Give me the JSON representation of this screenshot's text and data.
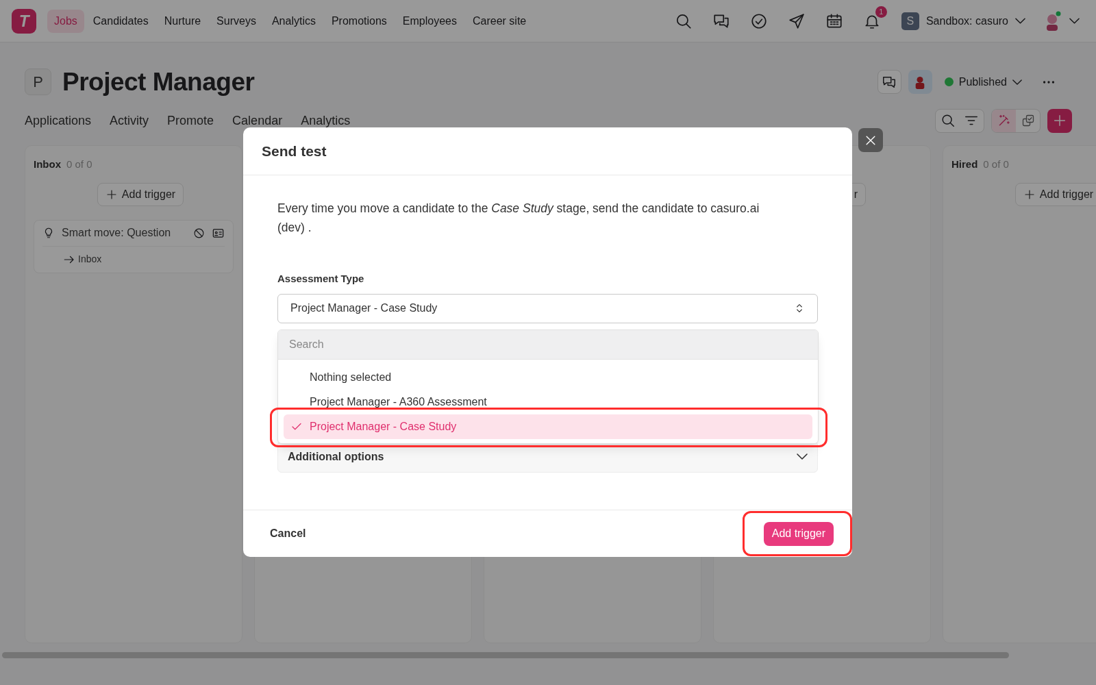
{
  "nav": {
    "logo": "T",
    "items": [
      {
        "label": "Jobs",
        "selected": true
      },
      {
        "label": "Candidates",
        "selected": false
      },
      {
        "label": "Nurture",
        "selected": false
      },
      {
        "label": "Surveys",
        "selected": false
      },
      {
        "label": "Analytics",
        "selected": false
      },
      {
        "label": "Promotions",
        "selected": false
      },
      {
        "label": "Employees",
        "selected": false
      },
      {
        "label": "Career site",
        "selected": false
      }
    ],
    "notification_count": "1",
    "workspace_initial": "S",
    "workspace": "Sandbox: casuro"
  },
  "job": {
    "initial": "P",
    "title": "Project Manager",
    "status": "Published"
  },
  "tabs": [
    "Applications",
    "Activity",
    "Promote",
    "Calendar",
    "Analytics"
  ],
  "columns": [
    {
      "kind": "stage",
      "name": "Inbox",
      "count": "0 of 0",
      "add_label": "Add trigger",
      "triggers": [
        {
          "title": "Smart move: Question",
          "target": "Inbox"
        }
      ]
    },
    {
      "kind": "covered"
    },
    {
      "kind": "covered"
    },
    {
      "kind": "covered",
      "add_label": "r"
    },
    {
      "kind": "stage",
      "name": "Hired",
      "count": "0 of 0",
      "add_label": "Add trigger"
    }
  ],
  "dialog": {
    "title": "Send test",
    "description": "Every time you move a candidate to the *Case Study* stage, send the candidate to casuro.ai (dev) .",
    "field_label": "Assessment Type",
    "value": "Project Manager - Case Study",
    "search_placeholder": "Search",
    "options": [
      {
        "label": "Nothing selected",
        "selected": false
      },
      {
        "label": "Project Manager - A360 Assessment",
        "selected": false
      },
      {
        "label": "Project Manager - Case Study",
        "selected": true
      }
    ],
    "additional_options": "Additional options",
    "cancel": "Cancel",
    "submit": "Add trigger"
  }
}
